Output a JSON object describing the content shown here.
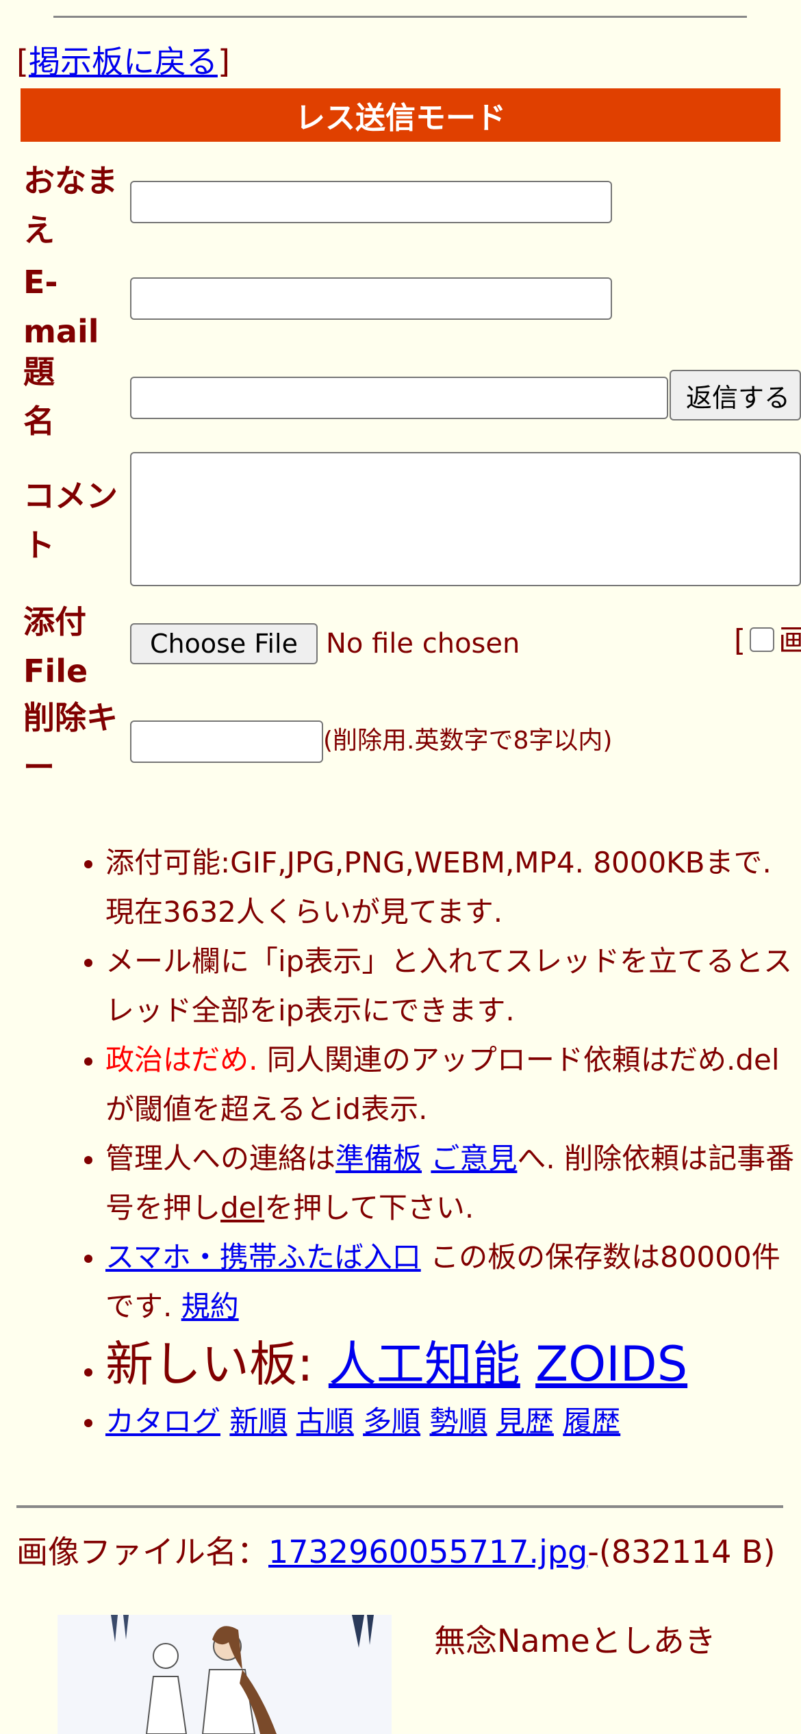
{
  "nav": {
    "back_open": "[",
    "back_link": "掲示板に戻る",
    "back_close": "]"
  },
  "banner": {
    "title": "レス送信モード",
    "color": "#e04000"
  },
  "form": {
    "name_label": "おなまえ",
    "email_label": "E-mail",
    "subject_label": "題名",
    "reply_button": "返信する",
    "comment_label": "コメント",
    "attach_label": "添付File",
    "choose_file_button": "Choose File",
    "no_file_text": "No file chosen",
    "bracket_open": "[",
    "picture_only_text": "画",
    "delkey_label": "削除キー",
    "delkey_hint": "(削除用.英数字で8字以内)"
  },
  "notes": {
    "n1": "添付可能:GIF,JPG,PNG,WEBM,MP4. 8000KBまで. 現在3632人くらいが見てます.",
    "n2": "メール欄に「ip表示」と入れてスレッドを立てるとスレッド全部をip表示にできます.",
    "n3_red": "政治はだめ.",
    "n3_rest": " 同人関連のアップロード依頼はだめ.delが閾値を超えるとid表示.",
    "n4_a": "管理人への連絡は",
    "n4_link1": "準備板",
    "n4_link2": "ご意見",
    "n4_b": "へ. 削除依頼は記事番号を押し",
    "n4_del": "del",
    "n4_c": "を押して下さい.",
    "n5_link": "スマホ・携帯ふたば入口",
    "n5_text": " この板の保存数は80000件です. ",
    "n5_terms": "規約",
    "n6_label": "新しい板: ",
    "n6_link1": "人工知能",
    "n6_link2": "ZOIDS",
    "sort_links": [
      "カタログ",
      "新順",
      "古順",
      "多順",
      "勢順",
      "見歴",
      "履歴"
    ]
  },
  "post": {
    "file_label": "画像ファイル名：",
    "file_name": "1732960055717.jpg",
    "file_size": "-(832114 B)",
    "poster": "無念Nameとしあき"
  }
}
